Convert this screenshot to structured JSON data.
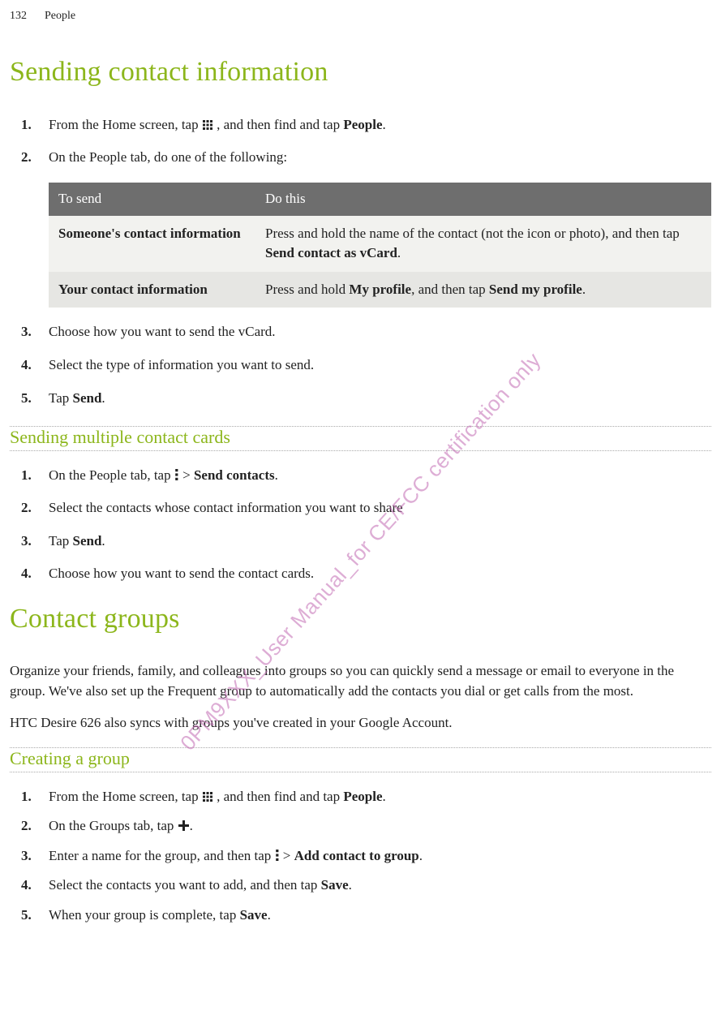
{
  "header": {
    "page_num": "132",
    "chapter": "People"
  },
  "watermark": "0PM9XXX_User Manual_for CE/FCC certification only",
  "s1": {
    "title": "Sending contact information",
    "steps": [
      {
        "n": "1.",
        "pre": "From the Home screen, tap ",
        "post": " , and then find and tap ",
        "bold": "People",
        "tail": "."
      },
      {
        "n": "2.",
        "text": "On the People tab, do one of the following:"
      }
    ],
    "table": {
      "head": {
        "c1": "To send",
        "c2": "Do this"
      },
      "r1": {
        "label": "Someone's contact information",
        "pre": "Press and hold the name of the contact (not the icon or photo), and then tap ",
        "bold": "Send contact as vCard",
        "tail": "."
      },
      "r2": {
        "label": "Your contact information",
        "pre": "Press and hold ",
        "b1": "My profile",
        "mid": ", and then tap ",
        "b2": "Send my profile",
        "tail": "."
      }
    },
    "steps2": [
      {
        "n": "3.",
        "text": "Choose how you want to send the vCard."
      },
      {
        "n": "4.",
        "text": "Select the type of information you want to send."
      },
      {
        "n": "5.",
        "pre": "Tap ",
        "bold": "Send",
        "tail": "."
      }
    ]
  },
  "s2": {
    "title": "Sending multiple contact cards",
    "steps": [
      {
        "n": "1.",
        "pre": "On the People tab, tap ",
        "mid": " > ",
        "bold": "Send contacts",
        "tail": "."
      },
      {
        "n": "2.",
        "text": "Select the contacts whose contact information you want to share"
      },
      {
        "n": "3.",
        "pre": "Tap ",
        "bold": "Send",
        "tail": "."
      },
      {
        "n": "4.",
        "text": "Choose how you want to send the contact cards."
      }
    ]
  },
  "s3": {
    "title": "Contact groups",
    "para1": "Organize your friends, family, and colleagues into groups so you can quickly send a message or email to everyone in the group. We've also set up the Frequent group to automatically add the contacts you dial or get calls from the most.",
    "para2": "HTC Desire 626 also syncs with groups you've created in your Google Account."
  },
  "s4": {
    "title": "Creating a group",
    "steps": [
      {
        "n": "1.",
        "pre": "From the Home screen, tap ",
        "post": " , and then find and tap ",
        "bold": "People",
        "tail": "."
      },
      {
        "n": "2.",
        "pre": "On the Groups tab, tap ",
        "tail": "."
      },
      {
        "n": "3.",
        "pre": "Enter a name for the group, and then tap ",
        "mid": " > ",
        "bold": "Add contact to group",
        "tail": "."
      },
      {
        "n": "4.",
        "pre": "Select the contacts you want to add, and then tap ",
        "bold": "Save",
        "tail": "."
      },
      {
        "n": "5.",
        "pre": "When your group is complete, tap ",
        "bold": "Save",
        "tail": "."
      }
    ]
  }
}
